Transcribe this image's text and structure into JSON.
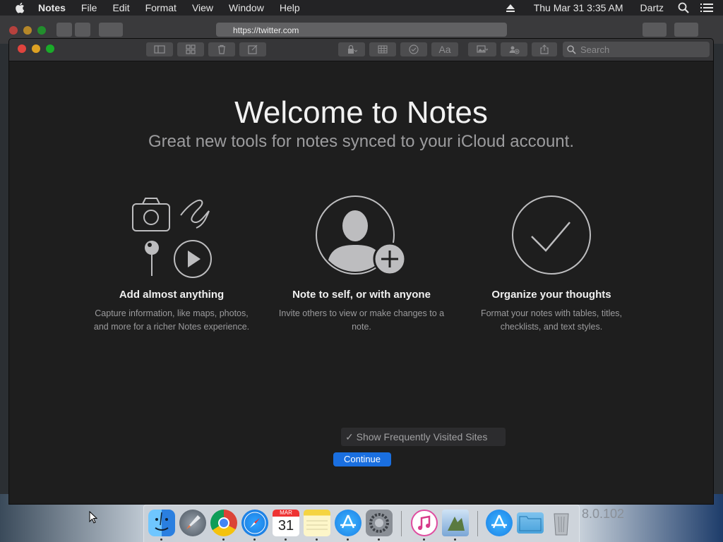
{
  "menubar": {
    "app_name": "Notes",
    "menus": [
      "File",
      "Edit",
      "Format",
      "View",
      "Window",
      "Help"
    ],
    "datetime": "Thu Mar 31  3:35 AM",
    "user": "Dartz"
  },
  "safari": {
    "url": "https://twitter.com"
  },
  "notes_window": {
    "search_placeholder": "Search",
    "welcome_title": "Welcome to Notes",
    "welcome_subtitle": "Great new tools for notes synced to your iCloud account.",
    "features": [
      {
        "title": "Add almost anything",
        "description": "Capture information, like maps, photos, and more for a richer Notes experience."
      },
      {
        "title": "Note to self, or with anyone",
        "description": "Invite others to view or make changes to a note."
      },
      {
        "title": "Organize your thoughts",
        "description": "Format your notes with tables, titles, checklists, and text styles."
      }
    ],
    "frequent_sites_label": "✓ Show Frequently Visited Sites",
    "continue_label": "Continue"
  },
  "desktop": {
    "background_text": "8.0.102"
  },
  "dock": {
    "calendar_month": "MAR",
    "calendar_day": "31",
    "apps": [
      "Finder",
      "Launchpad",
      "Chrome",
      "Safari",
      "Calendar",
      "Notes",
      "App Store",
      "System Preferences",
      "iTunes",
      "Preview"
    ]
  },
  "colors": {
    "accent": "#1a6fe0",
    "window_bg": "#1e1e1e",
    "titlebar": "#363638"
  }
}
